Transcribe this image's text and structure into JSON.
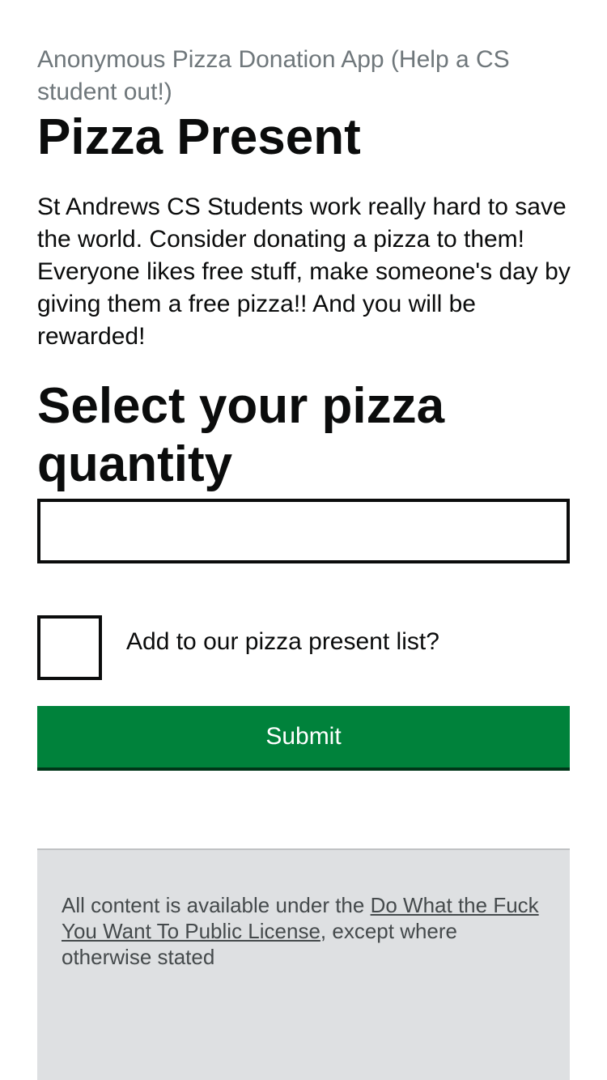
{
  "header": {
    "caption": "Anonymous Pizza Donation App (Help a CS student out!)",
    "title": "Pizza Present"
  },
  "main": {
    "intro": "St Andrews CS Students work really hard to save the world. Consider donating a pizza to them! Everyone likes free stuff, make someone's day by giving them a free pizza!! And you will be rewarded!",
    "quantity_heading": "Select your pizza quantity",
    "quantity_input": {
      "value": "",
      "placeholder": ""
    },
    "checkbox": {
      "label": "Add to our pizza present list?",
      "checked": false
    },
    "submit_label": "Submit"
  },
  "footer": {
    "prefix": "All content is available under the ",
    "link_text": "Do What the Fuck You Want To Public License",
    "suffix": ", except where otherwise stated"
  },
  "colors": {
    "submit_background": "#00823b",
    "footer_background": "#dee0e2",
    "caption_text": "#6f777b"
  }
}
